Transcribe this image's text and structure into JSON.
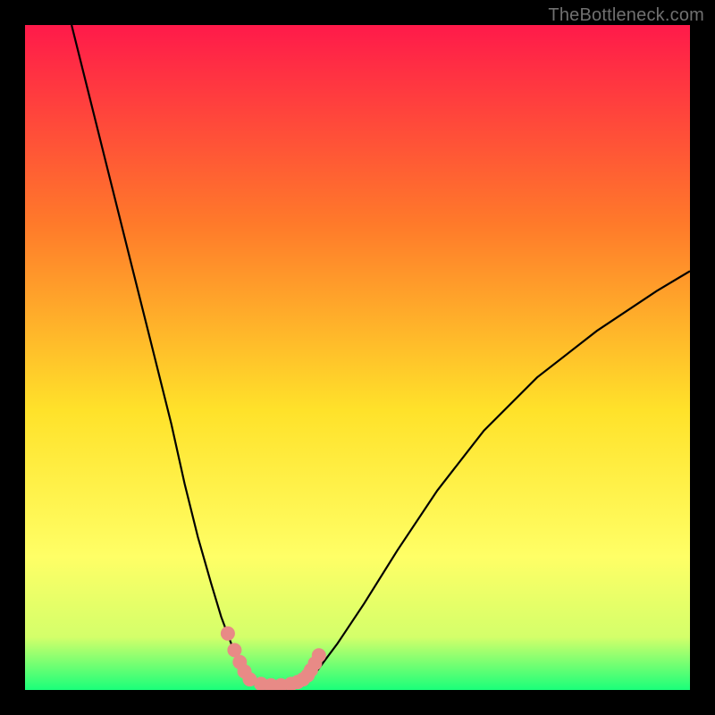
{
  "watermark": "TheBottleneck.com",
  "colors": {
    "frame": "#000000",
    "gradient_top": "#ff1a4a",
    "gradient_mid1": "#ff7a2a",
    "gradient_mid2": "#ffe22a",
    "gradient_mid3": "#ffff66",
    "gradient_mid4": "#d4ff6a",
    "gradient_bottom": "#1aff7a",
    "curve": "#000000",
    "markers": "#e88a86"
  },
  "chart_data": {
    "type": "line",
    "title": "",
    "xlabel": "",
    "ylabel": "",
    "xlim": [
      0,
      100
    ],
    "ylim": [
      0,
      100
    ],
    "series": [
      {
        "name": "left-branch",
        "x": [
          7,
          10,
          13,
          16,
          19,
          22,
          24,
          26,
          28,
          29.5,
          31,
          32,
          33,
          33.8
        ],
        "y": [
          100,
          88,
          76,
          64,
          52,
          40,
          31,
          23,
          16,
          11,
          7,
          4.5,
          2.5,
          1.2
        ]
      },
      {
        "name": "valley-floor",
        "x": [
          33.8,
          35,
          36.5,
          38,
          39.5,
          41,
          42.3
        ],
        "y": [
          1.2,
          0.6,
          0.4,
          0.35,
          0.4,
          0.6,
          1.2
        ]
      },
      {
        "name": "right-branch",
        "x": [
          42.3,
          44,
          47,
          51,
          56,
          62,
          69,
          77,
          86,
          95,
          100
        ],
        "y": [
          1.2,
          3,
          7,
          13,
          21,
          30,
          39,
          47,
          54,
          60,
          63
        ]
      }
    ],
    "markers": {
      "name": "highlighted-points",
      "x": [
        30.5,
        31.5,
        32.3,
        33,
        33.8,
        35.5,
        37,
        38.5,
        40,
        41,
        41.8,
        42.5,
        43,
        43.6,
        44.2
      ],
      "y": [
        8.5,
        6,
        4.2,
        2.8,
        1.6,
        0.9,
        0.7,
        0.7,
        0.9,
        1.2,
        1.6,
        2.2,
        3,
        4,
        5.2
      ]
    }
  }
}
